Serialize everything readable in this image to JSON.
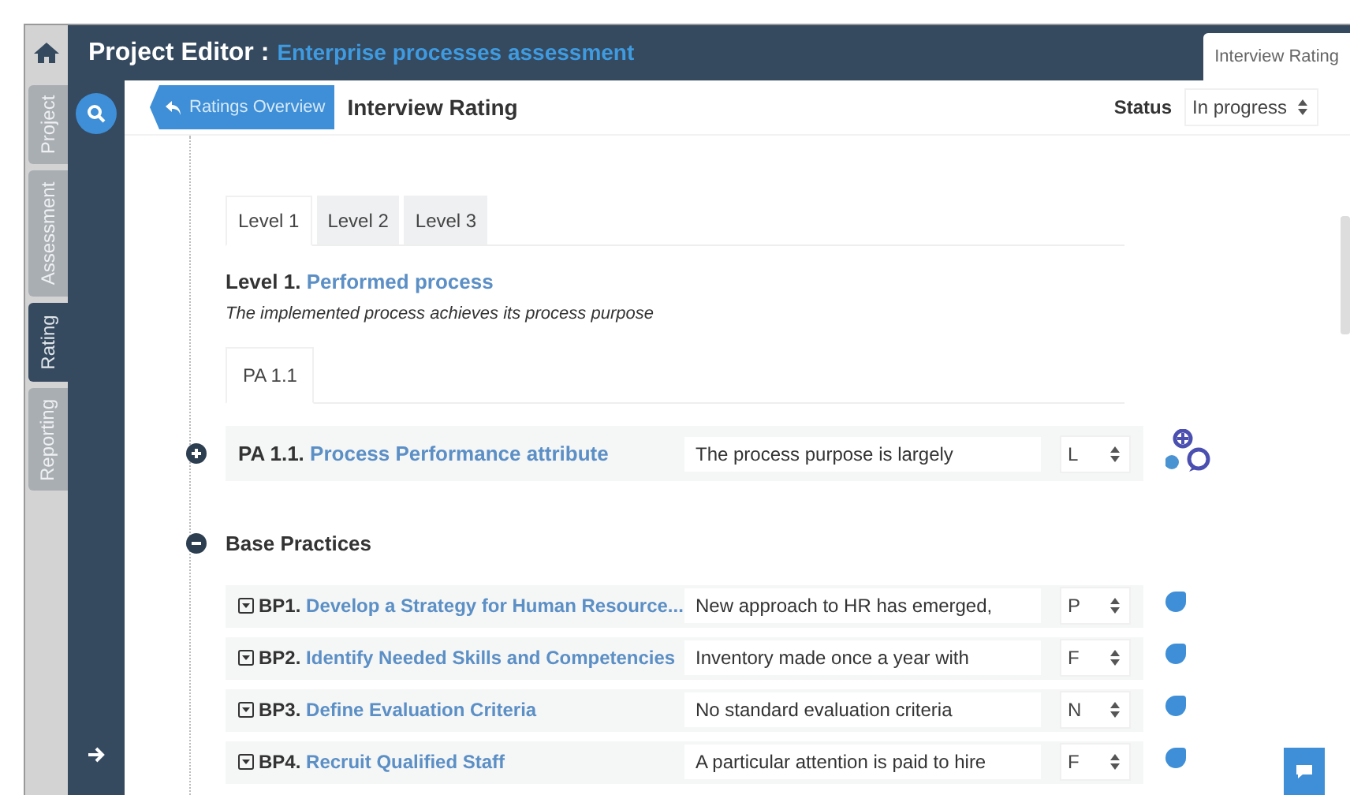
{
  "header": {
    "title": "Project Editor :",
    "project": "Enterprise processes assessment",
    "tab": "Interview Rating"
  },
  "side_tabs": [
    {
      "label": "Project",
      "selected": false
    },
    {
      "label": "Assessment",
      "selected": false
    },
    {
      "label": "Rating",
      "selected": true
    },
    {
      "label": "Reporting",
      "selected": false
    }
  ],
  "toolbar": {
    "back_button": "Ratings Overview",
    "title": "Interview Rating",
    "status_label": "Status",
    "status_value": "In progress"
  },
  "level_tabs": [
    {
      "label": "Level 1",
      "selected": true
    },
    {
      "label": "Level 2",
      "selected": false
    },
    {
      "label": "Level 3",
      "selected": false
    }
  ],
  "level": {
    "code": "Level 1.",
    "name": "Performed process",
    "description": "The implemented process achieves its process purpose"
  },
  "pa_tabs": [
    {
      "label": "PA 1.1",
      "selected": true
    }
  ],
  "attribute": {
    "code": "PA 1.1.",
    "name": "Process Performance attribute",
    "comment": "The process purpose is largely",
    "rating": "L",
    "expanded": false
  },
  "base_practices": {
    "title": "Base Practices",
    "expanded": true,
    "items": [
      {
        "code": "BP1.",
        "name": "Develop a Strategy for Human Resource...",
        "comment": "New approach to HR has emerged,",
        "rating": "P"
      },
      {
        "code": "BP2.",
        "name": "Identify Needed Skills and Competencies",
        "comment": "Inventory made once a year with",
        "rating": "F"
      },
      {
        "code": "BP3.",
        "name": "Define Evaluation Criteria",
        "comment": "No standard evaluation criteria",
        "rating": "N"
      },
      {
        "code": "BP4.",
        "name": "Recruit Qualified Staff",
        "comment": "A particular attention is paid to hire",
        "rating": "F"
      }
    ]
  }
}
